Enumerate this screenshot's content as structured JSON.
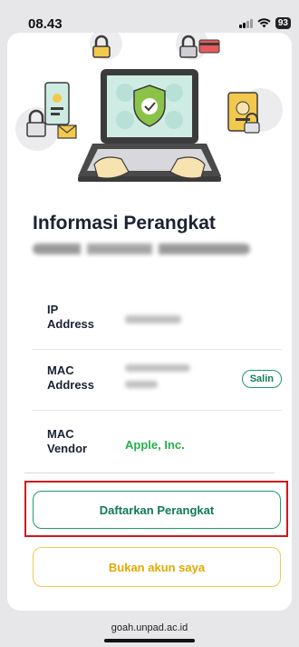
{
  "status_bar": {
    "time": "08.43",
    "battery": "93"
  },
  "device_info": {
    "title": "Informasi Perangkat",
    "rows": [
      {
        "label": "IP Address"
      },
      {
        "label": "MAC Address",
        "action": "Salin"
      },
      {
        "label": "MAC Vendor",
        "value": "Apple, Inc."
      }
    ]
  },
  "actions": {
    "register": "Daftarkan Perangkat",
    "not_my_account": "Bukan akun saya"
  },
  "browser": {
    "url": "goah.unpad.ac.id"
  },
  "colors": {
    "accent_green": "#1e9a76",
    "vendor_green": "#22b14c",
    "secondary_yellow": "#f2c94c",
    "highlight_red": "#d0161e"
  }
}
